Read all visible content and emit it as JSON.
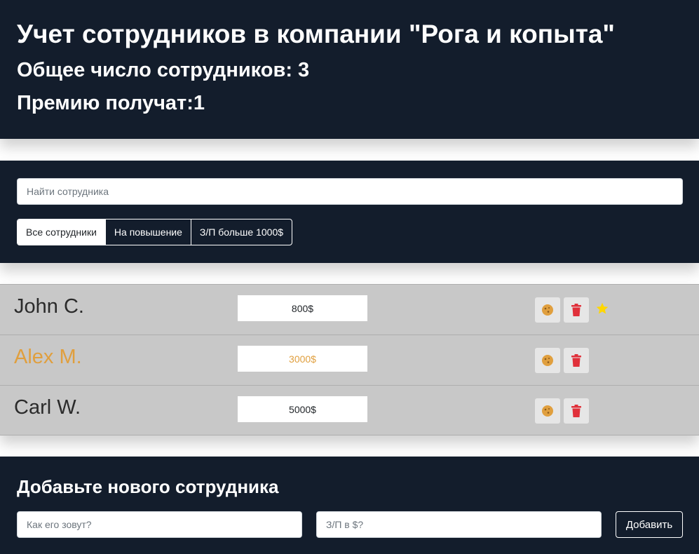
{
  "header": {
    "title": "Учет сотрудников в компании \"Рога и копыта\"",
    "total": "Общее число сотрудников: 3",
    "bonus": "Премию получат:1"
  },
  "search": {
    "placeholder": "Найти сотрудника",
    "value": ""
  },
  "filters": [
    {
      "label": "Все сотрудники",
      "active": true
    },
    {
      "label": "На повышение",
      "active": false
    },
    {
      "label": "З/П больше 1000$",
      "active": false
    }
  ],
  "employees": [
    {
      "name": "John C.",
      "salary": "800$",
      "increase": false,
      "starred": true
    },
    {
      "name": "Alex M.",
      "salary": "3000$",
      "increase": true,
      "starred": false
    },
    {
      "name": "Carl W.",
      "salary": "5000$",
      "increase": false,
      "starred": false
    }
  ],
  "add_form": {
    "title": "Добавьте нового сотрудника",
    "name_placeholder": "Как его зовут?",
    "salary_placeholder": "З/П в $?",
    "submit_label": "Добавить"
  },
  "icons": {
    "cookie": "cookie-icon",
    "trash": "trash-icon",
    "star": "star-icon"
  },
  "colors": {
    "panel_bg": "#131d2c",
    "accent_increase": "#e09f3e",
    "trash": "#e0303a",
    "star": "#ffd700"
  }
}
